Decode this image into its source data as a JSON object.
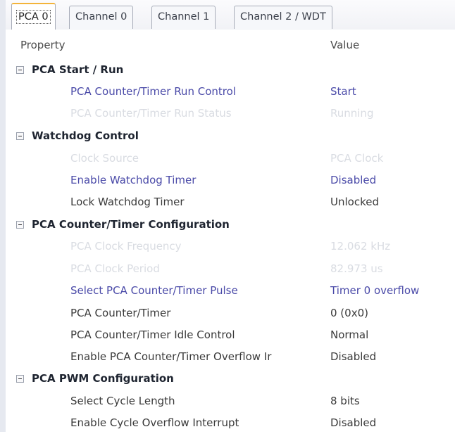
{
  "tabs": [
    {
      "label": "PCA 0",
      "active": true
    },
    {
      "label": "Channel 0",
      "active": false
    },
    {
      "label": "Channel 1",
      "active": false
    },
    {
      "label": "Channel 2 / WDT",
      "active": false
    }
  ],
  "columns": {
    "property": "Property",
    "value": "Value"
  },
  "categories": [
    {
      "title": "PCA Start / Run",
      "rows": [
        {
          "name": "PCA Counter/Timer Run Control",
          "value": "Start",
          "state": "editable"
        },
        {
          "name": "PCA Counter/Timer Run Status",
          "value": "Running",
          "state": "disabled"
        }
      ]
    },
    {
      "title": "Watchdog Control",
      "rows": [
        {
          "name": "Clock Source",
          "value": "PCA Clock",
          "state": "disabled"
        },
        {
          "name": "Enable Watchdog Timer",
          "value": "Disabled",
          "state": "editable"
        },
        {
          "name": "Lock Watchdog Timer",
          "value": "Unlocked",
          "state": "readonly"
        }
      ]
    },
    {
      "title": "PCA Counter/Timer Configuration",
      "rows": [
        {
          "name": "PCA Clock Frequency",
          "value": "12.062 kHz",
          "state": "disabled"
        },
        {
          "name": "PCA Clock Period",
          "value": "82.973 us",
          "state": "disabled"
        },
        {
          "name": "Select PCA Counter/Timer Pulse",
          "value": "Timer 0 overflow",
          "state": "editable"
        },
        {
          "name": "PCA Counter/Timer",
          "value": "0 (0x0)",
          "state": "readonly"
        },
        {
          "name": "PCA Counter/Timer Idle Control",
          "value": "Normal",
          "state": "readonly"
        },
        {
          "name": "Enable PCA Counter/Timer Overflow Ir",
          "value": "Disabled",
          "state": "readonly"
        }
      ]
    },
    {
      "title": "PCA PWM Configuration",
      "rows": [
        {
          "name": "Select Cycle Length",
          "value": "8 bits",
          "state": "readonly"
        },
        {
          "name": "Enable Cycle Overflow Interrupt",
          "value": "Disabled",
          "state": "readonly"
        }
      ]
    }
  ],
  "colors": {
    "editable_text": "#4a4aa8",
    "readonly_text": "#3a3a3a",
    "disabled_text": "#d9dce2",
    "active_tab_accent": "#f3b43a"
  },
  "icons": {
    "category_toggle": "minus-box-icon"
  }
}
